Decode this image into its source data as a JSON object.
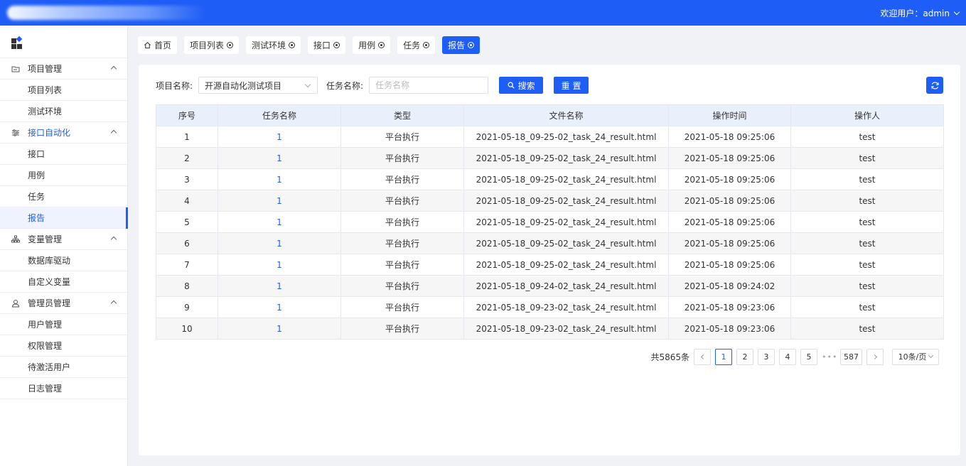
{
  "header": {
    "user_label": "欢迎用户：admin",
    "brand_color": "#1e5df6"
  },
  "sidebar": {
    "groups": [
      {
        "label": "项目管理",
        "icon": "folder-icon",
        "items": [
          "项目列表",
          "测试环境"
        ]
      },
      {
        "label": "接口自动化",
        "icon": "sliders-icon",
        "items": [
          "接口",
          "用例",
          "任务",
          "报告"
        ]
      },
      {
        "label": "变量管理",
        "icon": "hierarchy-icon",
        "items": [
          "数据库驱动",
          "自定义变量"
        ]
      },
      {
        "label": "管理员管理",
        "icon": "user-icon",
        "items": [
          "用户管理",
          "权限管理",
          "待激活用户",
          "日志管理"
        ]
      }
    ],
    "active_group": "接口自动化",
    "active_item": "报告"
  },
  "tabs": [
    {
      "label": "首页",
      "icon": "home-icon",
      "closable": false
    },
    {
      "label": "项目列表",
      "closable": true
    },
    {
      "label": "测试环境",
      "closable": true
    },
    {
      "label": "接口",
      "closable": true
    },
    {
      "label": "用例",
      "closable": true
    },
    {
      "label": "任务",
      "closable": true
    },
    {
      "label": "报告",
      "closable": true,
      "active": true
    }
  ],
  "search": {
    "project_label": "项目名称:",
    "project_value": "开源自动化测试项目",
    "task_label": "任务名称:",
    "task_placeholder": "任务名称",
    "search_button": "搜索",
    "reset_button": "重 置"
  },
  "table": {
    "columns": [
      "序号",
      "任务名称",
      "类型",
      "文件名称",
      "操作时间",
      "操作人"
    ],
    "rows": [
      [
        "1",
        "1",
        "平台执行",
        "2021-05-18_09-25-02_task_24_result.html",
        "2021-05-18 09:25:06",
        "test"
      ],
      [
        "2",
        "1",
        "平台执行",
        "2021-05-18_09-25-02_task_24_result.html",
        "2021-05-18 09:25:06",
        "test"
      ],
      [
        "3",
        "1",
        "平台执行",
        "2021-05-18_09-25-02_task_24_result.html",
        "2021-05-18 09:25:06",
        "test"
      ],
      [
        "4",
        "1",
        "平台执行",
        "2021-05-18_09-25-02_task_24_result.html",
        "2021-05-18 09:25:06",
        "test"
      ],
      [
        "5",
        "1",
        "平台执行",
        "2021-05-18_09-25-02_task_24_result.html",
        "2021-05-18 09:25:06",
        "test"
      ],
      [
        "6",
        "1",
        "平台执行",
        "2021-05-18_09-25-02_task_24_result.html",
        "2021-05-18 09:25:06",
        "test"
      ],
      [
        "7",
        "1",
        "平台执行",
        "2021-05-18_09-25-02_task_24_result.html",
        "2021-05-18 09:25:06",
        "test"
      ],
      [
        "8",
        "1",
        "平台执行",
        "2021-05-18_09-24-02_task_24_result.html",
        "2021-05-18 09:24:02",
        "test"
      ],
      [
        "9",
        "1",
        "平台执行",
        "2021-05-18_09-23-02_task_24_result.html",
        "2021-05-18 09:23:06",
        "test"
      ],
      [
        "10",
        "1",
        "平台执行",
        "2021-05-18_09-23-02_task_24_result.html",
        "2021-05-18 09:23:06",
        "test"
      ]
    ]
  },
  "pagination": {
    "total_label": "共5865条",
    "pages": [
      "1",
      "2",
      "3",
      "4",
      "5"
    ],
    "current": "1",
    "ellipsis": "•••",
    "last_page": "587",
    "page_size": "10条/页"
  }
}
